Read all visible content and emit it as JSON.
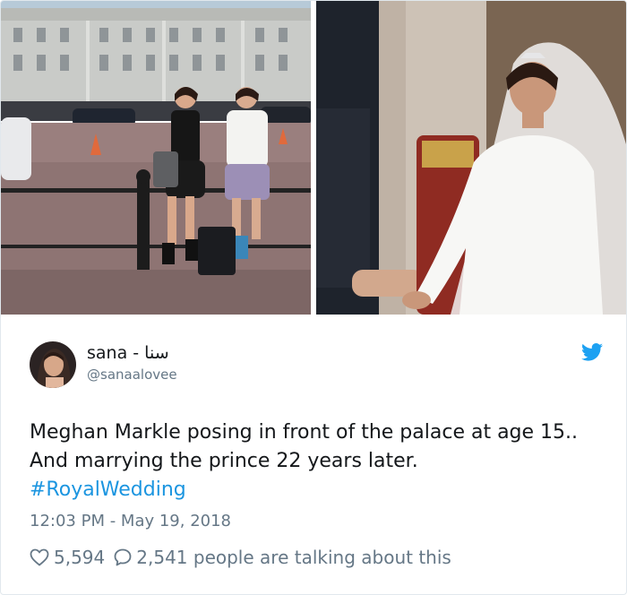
{
  "tweet": {
    "display_name": "sana - سنا",
    "handle": "@sanaalovee",
    "text": "Meghan Markle posing in front of the palace at age 15.. And marrying the prince 22 years later.",
    "hashtag": "#RoyalWedding",
    "timestamp": "12:03 PM - May 19, 2018",
    "likes": "5,594",
    "talking": "2,541 people are talking about this"
  },
  "icons": {
    "brand": "twitter-bird-icon",
    "like": "heart-icon",
    "reply": "speech-bubble-icon"
  },
  "colors": {
    "twitter_blue": "#1da1f2",
    "link": "#1b95e0",
    "muted_text": "#657786",
    "text": "#14171a"
  }
}
